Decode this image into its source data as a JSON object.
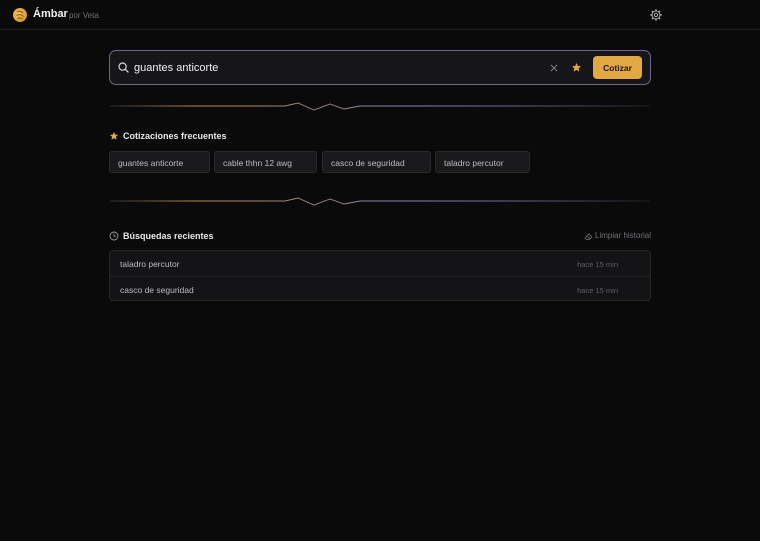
{
  "app": {
    "name": "Ámbar",
    "by": "por Veta"
  },
  "search": {
    "value": "guantes anticorte",
    "placeholder": "",
    "submit_label": "Cotizar"
  },
  "frequent": {
    "title": "Cotizaciones frecuentes",
    "items": [
      "guantes anticorte",
      "cable thhn 12 awg",
      "casco de seguridad",
      "taladro percutor"
    ]
  },
  "recent": {
    "title": "Búsquedas recientes",
    "clear_label": "Limpiar historial",
    "items": [
      {
        "query": "taladro percutor",
        "time": "hace 15 min"
      },
      {
        "query": "casco de seguridad",
        "time": "hace 15 min"
      }
    ]
  },
  "colors": {
    "accent": "#e3a743",
    "focus_border": "#6b6890",
    "background": "#0a0a0b"
  },
  "icons": {
    "logo": "amber-logo-icon",
    "settings": "gear-icon",
    "search": "search-icon",
    "clear": "close-icon",
    "favorite": "star-icon",
    "recent": "clock-icon",
    "clear_history": "eraser-icon"
  }
}
